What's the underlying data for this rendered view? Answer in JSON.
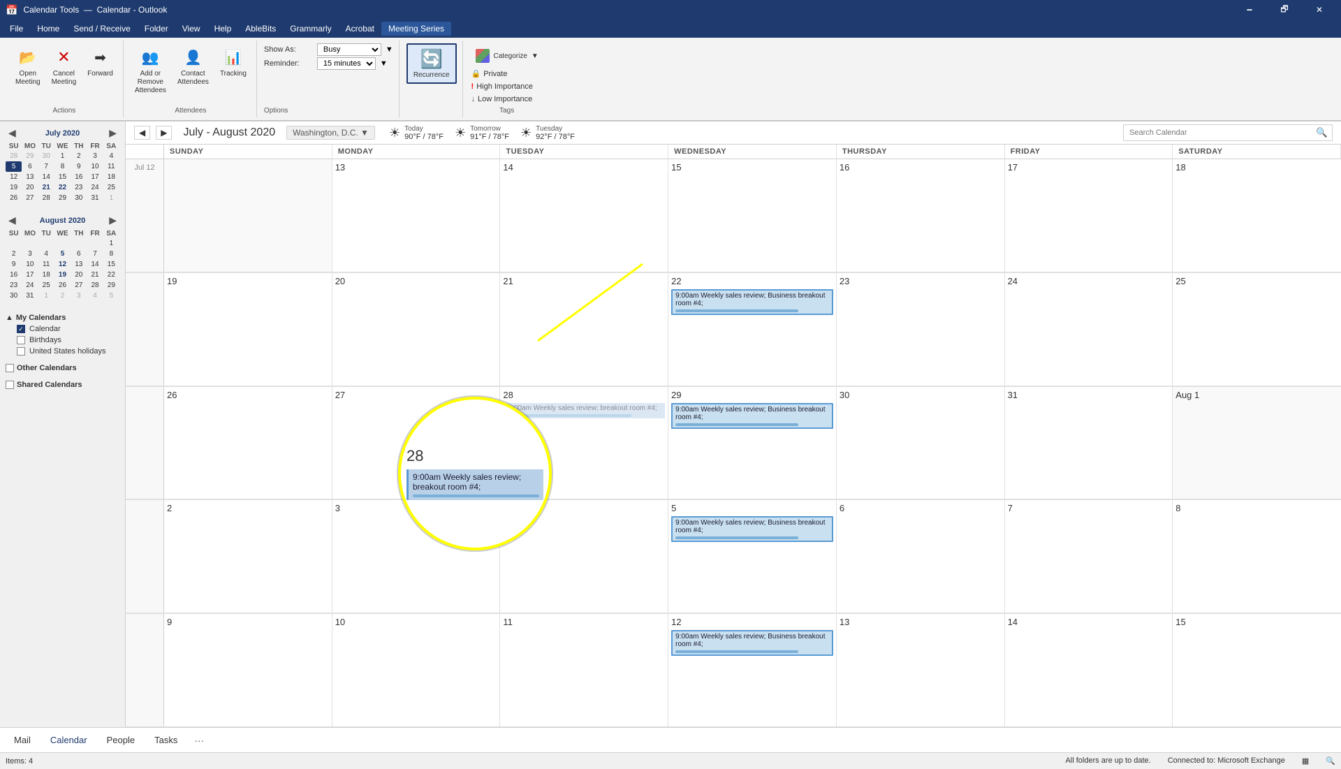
{
  "titleBar": {
    "appName": "Calendar Tools",
    "title": "Calendar - ",
    "appSuffix": "Outlook",
    "minimize": "🗕",
    "maximize": "🗗",
    "close": "✕"
  },
  "menuBar": {
    "items": [
      "File",
      "Home",
      "Send / Receive",
      "Folder",
      "View",
      "Help",
      "AbleBits",
      "Grammarly",
      "Acrobat",
      "Meeting Series"
    ]
  },
  "ribbon": {
    "activeTab": "Meeting Series",
    "groups": {
      "actions": {
        "label": "Actions",
        "buttons": [
          {
            "icon": "📂",
            "label": "Open Meeting"
          },
          {
            "icon": "✕",
            "label": "Cancel Meeting"
          },
          {
            "icon": "➡",
            "label": "Forward"
          }
        ]
      },
      "attendees": {
        "label": "Attendees",
        "buttons": [
          {
            "icon": "👥",
            "label": "Add or Remove Attendees"
          },
          {
            "icon": "👤",
            "label": "Contact Attendees"
          },
          {
            "icon": "📊",
            "label": "Tracking"
          }
        ]
      },
      "options": {
        "label": "Options",
        "showAs": "Show As:",
        "showAsValue": "Busy",
        "reminder": "Reminder:",
        "reminderValue": "15 minutes"
      },
      "recurrence": {
        "icon": "🔄",
        "label": "Recurrence"
      },
      "tags": {
        "label": "Tags",
        "categorize": "Categorize",
        "private": "Private",
        "highImportance": "High Importance",
        "lowImportance": "Low Importance"
      }
    }
  },
  "sidebar": {
    "julyCal": {
      "title": "July 2020",
      "dayHeaders": [
        "SU",
        "MO",
        "TU",
        "WE",
        "TH",
        "FR",
        "SA"
      ],
      "weeks": [
        [
          "28",
          "29",
          "30",
          "1",
          "2",
          "3",
          "4"
        ],
        [
          "5",
          "6",
          "7",
          "8",
          "9",
          "10",
          "11"
        ],
        [
          "12",
          "13",
          "14",
          "15",
          "16",
          "17",
          "18"
        ],
        [
          "19",
          "20",
          "21",
          "22",
          "23",
          "24",
          "25"
        ],
        [
          "26",
          "27",
          "28",
          "29",
          "30",
          "31",
          "1"
        ]
      ],
      "todayDate": "5"
    },
    "augCal": {
      "title": "August 2020",
      "dayHeaders": [
        "SU",
        "MO",
        "TU",
        "WE",
        "TH",
        "FR",
        "SA"
      ],
      "weeks": [
        [
          "",
          "",
          "",
          "",
          "",
          "",
          "1"
        ],
        [
          "2",
          "3",
          "4",
          "5",
          "6",
          "7",
          "8"
        ],
        [
          "9",
          "10",
          "11",
          "12",
          "13",
          "14",
          "15"
        ],
        [
          "16",
          "17",
          "18",
          "19",
          "20",
          "21",
          "22"
        ],
        [
          "23",
          "24",
          "25",
          "26",
          "27",
          "28",
          "29"
        ],
        [
          "30",
          "31",
          "1",
          "2",
          "3",
          "4",
          "5"
        ]
      ]
    },
    "myCalendars": {
      "label": "My Calendars",
      "items": [
        {
          "name": "Calendar",
          "checked": true
        },
        {
          "name": "Birthdays",
          "checked": false
        },
        {
          "name": "United States holidays",
          "checked": false
        }
      ]
    },
    "otherCalendars": {
      "label": "Other Calendars",
      "checked": false
    },
    "sharedCalendars": {
      "label": "Shared Calendars",
      "checked": false
    }
  },
  "calendarView": {
    "navTitle": "July - August 2020",
    "location": "Washington, D.C.",
    "weather": [
      {
        "icon": "☀",
        "label": "Today",
        "temp": "90°F / 78°F"
      },
      {
        "icon": "☀",
        "label": "Tomorrow",
        "temp": "91°F / 78°F"
      },
      {
        "icon": "☀",
        "label": "Tuesday",
        "temp": "92°F / 78°F"
      }
    ],
    "searchPlaceholder": "Search Calendar",
    "dayHeaders": [
      "SUNDAY",
      "MONDAY",
      "TUESDAY",
      "WEDNESDAY",
      "THURSDAY",
      "FRIDAY",
      "SATURDAY"
    ],
    "weeks": [
      {
        "weekLabel": "Jul 12",
        "days": [
          {
            "date": "",
            "otherMonth": true,
            "events": []
          },
          {
            "date": "13",
            "events": []
          },
          {
            "date": "14",
            "events": []
          },
          {
            "date": "15",
            "events": []
          },
          {
            "date": "16",
            "events": []
          },
          {
            "date": "17",
            "events": []
          },
          {
            "date": "18",
            "events": []
          }
        ]
      },
      {
        "weekLabel": "",
        "days": [
          {
            "date": "19",
            "events": []
          },
          {
            "date": "20",
            "events": []
          },
          {
            "date": "21",
            "events": []
          },
          {
            "date": "22",
            "events": [
              {
                "time": "9:00am",
                "title": "Weekly sales review; Business breakout room #4;",
                "selected": true
              }
            ]
          },
          {
            "date": "23",
            "events": []
          },
          {
            "date": "24",
            "events": []
          },
          {
            "date": "25",
            "events": []
          }
        ]
      },
      {
        "weekLabel": "",
        "days": [
          {
            "date": "26",
            "events": []
          },
          {
            "date": "27",
            "events": []
          },
          {
            "date": "28",
            "events": [
              {
                "time": "9:00am",
                "title": "Weekly sales review; breakout room #4;",
                "zoom": true
              }
            ]
          },
          {
            "date": "29",
            "events": [
              {
                "time": "9:00am",
                "title": "Weekly sales review; Business breakout room #4;",
                "selected": true
              }
            ]
          },
          {
            "date": "30",
            "events": []
          },
          {
            "date": "31",
            "events": []
          },
          {
            "date": "Aug 1",
            "otherMonth": true,
            "events": []
          }
        ]
      },
      {
        "weekLabel": "",
        "days": [
          {
            "date": "2",
            "events": []
          },
          {
            "date": "3",
            "events": []
          },
          {
            "date": "4",
            "events": []
          },
          {
            "date": "5",
            "events": [
              {
                "time": "9:00am",
                "title": "Weekly sales review; Business breakout room #4;",
                "selected": true
              }
            ]
          },
          {
            "date": "6",
            "events": []
          },
          {
            "date": "7",
            "events": []
          },
          {
            "date": "8",
            "events": []
          }
        ]
      },
      {
        "weekLabel": "",
        "days": [
          {
            "date": "9",
            "events": []
          },
          {
            "date": "10",
            "events": []
          },
          {
            "date": "11",
            "events": []
          },
          {
            "date": "12",
            "events": [
              {
                "time": "9:00am",
                "title": "Weekly sales review; Business breakout room #4;",
                "selected": true
              }
            ]
          },
          {
            "date": "13",
            "events": []
          },
          {
            "date": "14",
            "events": []
          },
          {
            "date": "15",
            "events": []
          }
        ]
      }
    ]
  },
  "statusBar": {
    "itemCount": "Items: 4",
    "syncStatus": "All folders are up to date.",
    "connectionStatus": "Connected to: Microsoft Exchange"
  },
  "bottomNav": {
    "items": [
      "Mail",
      "Calendar",
      "People",
      "Tasks"
    ],
    "activeItem": "Calendar",
    "more": "···"
  }
}
